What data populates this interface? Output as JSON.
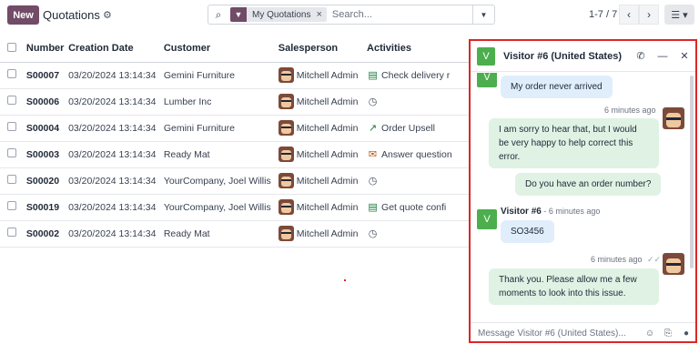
{
  "toolbar": {
    "new_label": "New",
    "title": "Quotations",
    "settings_icon": "gear-icon",
    "search_icon": "search-icon",
    "filter_facet": "My Quotations",
    "facet_remove": "×",
    "search_placeholder": "Search...",
    "search_toggle_icon": "caret-down-icon",
    "pager": "1-7 / 7",
    "prev": "‹",
    "next": "›",
    "view_switch_icon": "list-view-icon"
  },
  "table": {
    "headers": [
      "Number",
      "Creation Date",
      "Customer",
      "Salesperson",
      "Activities"
    ],
    "rows": [
      {
        "number": "S00007",
        "date": "03/20/2024 13:14:34",
        "customer": "Gemini Furniture",
        "salesperson": "Mitchell Admin",
        "activity": "Check delivery r",
        "activity_icon": "spreadsheet-icon",
        "activity_color": "green"
      },
      {
        "number": "S00006",
        "date": "03/20/2024 13:14:34",
        "customer": "Lumber Inc",
        "salesperson": "Mitchell Admin",
        "activity": "",
        "activity_icon": "clock-icon",
        "activity_color": "grey"
      },
      {
        "number": "S00004",
        "date": "03/20/2024 13:14:34",
        "customer": "Gemini Furniture",
        "salesperson": "Mitchell Admin",
        "activity": "Order Upsell",
        "activity_icon": "trend-line-icon",
        "activity_color": "green"
      },
      {
        "number": "S00003",
        "date": "03/20/2024 13:14:34",
        "customer": "Ready Mat",
        "salesperson": "Mitchell Admin",
        "activity": "Answer question",
        "activity_icon": "envelope-icon",
        "activity_color": "brown"
      },
      {
        "number": "S00020",
        "date": "03/20/2024 13:14:34",
        "customer": "YourCompany, Joel Willis",
        "salesperson": "Mitchell Admin",
        "activity": "",
        "activity_icon": "clock-icon",
        "activity_color": "grey"
      },
      {
        "number": "S00019",
        "date": "03/20/2024 13:14:34",
        "customer": "YourCompany, Joel Willis",
        "salesperson": "Mitchell Admin",
        "activity": "Get quote confi",
        "activity_icon": "spreadsheet-icon",
        "activity_color": "green"
      },
      {
        "number": "S00002",
        "date": "03/20/2024 13:14:34",
        "customer": "Ready Mat",
        "salesperson": "Mitchell Admin",
        "activity": "",
        "activity_icon": "clock-icon",
        "activity_color": "grey"
      }
    ]
  },
  "chat": {
    "visitor_initial": "V",
    "title": "Visitor #6 (United States)",
    "phone_icon": "phone-icon",
    "minimize_icon": "minimize-icon",
    "close_icon": "close-icon",
    "messages": [
      {
        "text": "My order never arrived"
      },
      {
        "meta": "6 minutes ago",
        "text": "I am sorry to hear that, but I would be very happy to help correct this error."
      },
      {
        "text": "Do you have an order number?"
      },
      {
        "author": "Visitor #6",
        "meta": "- 6 minutes ago",
        "text": "SO3456"
      },
      {
        "meta": "6 minutes ago",
        "seen_icon": "double-check-icon",
        "text": "Thank you. Please allow me a few moments to look into this issue."
      }
    ],
    "composer_placeholder": "Message Visitor #6 (United States)...",
    "emoji_icon": "smiley-icon",
    "attach_icon": "paperclip-icon",
    "mic_icon": "microphone-icon"
  },
  "colors": {
    "brand": "#714b67",
    "visitor_green": "#4cae4c",
    "highlight_border": "#dc2626",
    "incoming_bubble": "#e0eefb",
    "outgoing_bubble": "#dff2e4"
  }
}
